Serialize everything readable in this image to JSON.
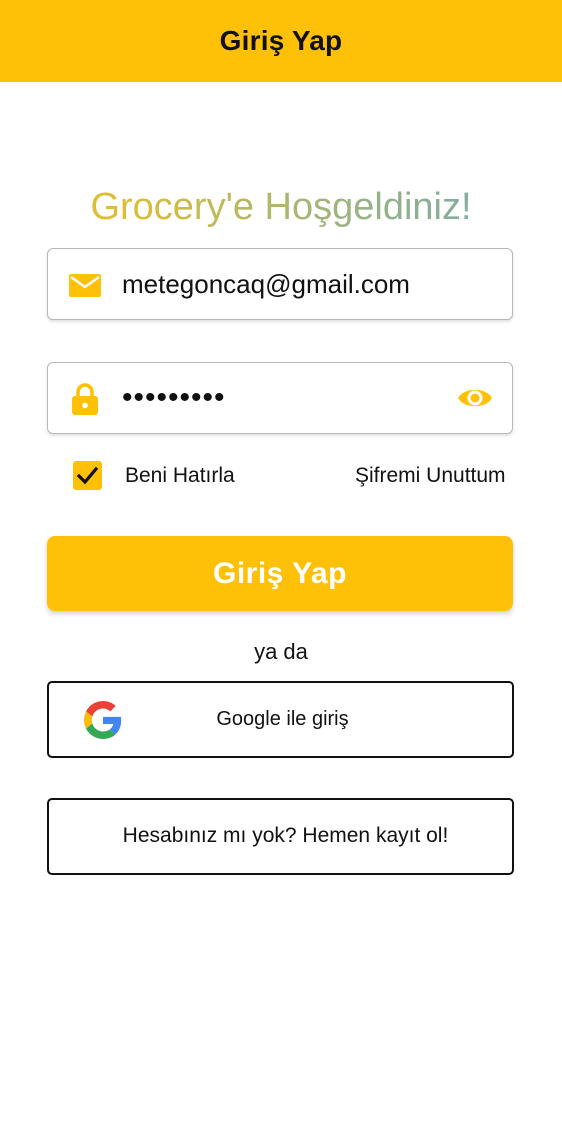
{
  "appbar": {
    "title": "Giriş Yap",
    "color": "#FFC107"
  },
  "welcome": {
    "text": "Grocery'e Hoşgeldiniz!"
  },
  "email_field": {
    "icon": "mail-icon",
    "value": "metegoncaq@gmail.com"
  },
  "password_field": {
    "icon": "lock-icon",
    "value": "•••••••••",
    "toggle_icon": "eye-icon"
  },
  "remember": {
    "checked": true,
    "label": "Beni Hatırla"
  },
  "forgot": {
    "label": "Şifremi Unuttum"
  },
  "login_button": {
    "label": "Giriş Yap"
  },
  "divider": {
    "text": "ya da"
  },
  "google_button": {
    "icon": "google-logo-icon",
    "label": "Google ile giriş"
  },
  "register_button": {
    "label": "Hesabınız mı yok? Hemen kayıt ol!"
  },
  "colors": {
    "accent": "#FFC107",
    "text": "#111111"
  }
}
